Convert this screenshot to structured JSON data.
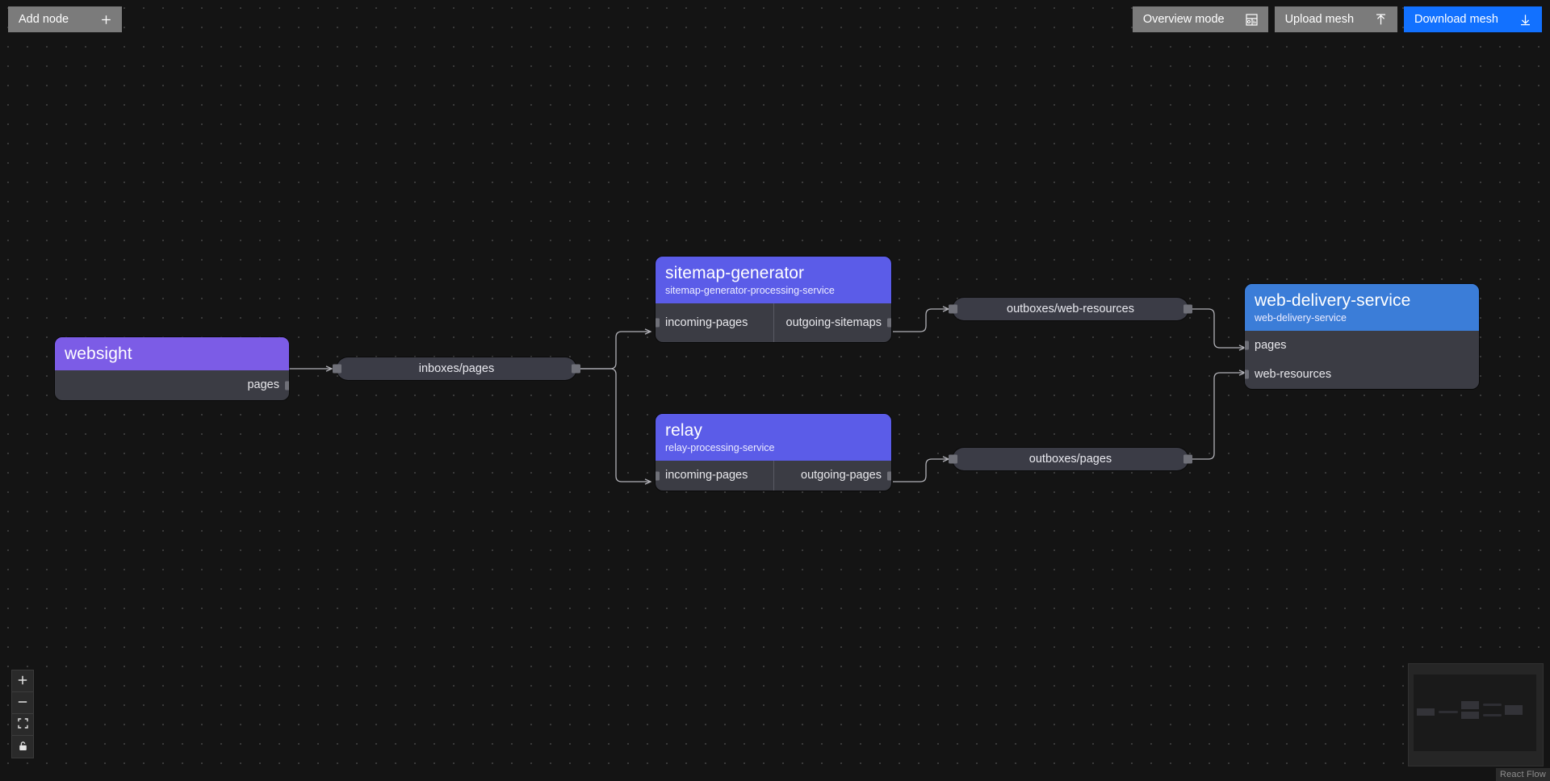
{
  "toolbar": {
    "add_node": {
      "label": "Add node",
      "icon": "plus-icon"
    },
    "overview_mode": {
      "label": "Overview mode",
      "icon": "layout-grid-icon"
    },
    "upload_mesh": {
      "label": "Upload mesh",
      "icon": "upload-icon"
    },
    "download_mesh": {
      "label": "Download mesh",
      "icon": "download-icon",
      "color": "#1271ff"
    }
  },
  "canvas": {
    "background": "#141414",
    "dot_color": "#3a3a3a",
    "edge_color": "#b1b1b7"
  },
  "nodes": [
    {
      "id": "websight",
      "title": "websight",
      "subtitle": "",
      "header_color": "#7c5ce6",
      "ports_in": [],
      "ports_out": [
        "pages"
      ]
    },
    {
      "id": "sitemap-generator",
      "title": "sitemap-generator",
      "subtitle": "sitemap-generator-processing-service",
      "header_color": "#5b5ce8",
      "ports_in": [
        "incoming-pages"
      ],
      "ports_out": [
        "outgoing-sitemaps"
      ]
    },
    {
      "id": "relay",
      "title": "relay",
      "subtitle": "relay-processing-service",
      "header_color": "#5b5ce8",
      "ports_in": [
        "incoming-pages"
      ],
      "ports_out": [
        "outgoing-pages"
      ]
    },
    {
      "id": "web-delivery-service",
      "title": "web-delivery-service",
      "subtitle": "web-delivery-service",
      "header_color": "#3b7dd8",
      "ports_in": [
        "pages",
        "web-resources"
      ],
      "ports_out": []
    }
  ],
  "topics": [
    {
      "id": "inboxes-pages",
      "label": "inboxes/pages"
    },
    {
      "id": "outboxes-web-resources",
      "label": "outboxes/web-resources"
    },
    {
      "id": "outboxes-pages",
      "label": "outboxes/pages"
    }
  ],
  "controls": [
    {
      "name": "zoom-in",
      "glyph": "+"
    },
    {
      "name": "zoom-out",
      "glyph": "−"
    },
    {
      "name": "fit-view",
      "glyph": "fit"
    },
    {
      "name": "lock",
      "glyph": "lock"
    }
  ],
  "minimap": {
    "visible": true
  },
  "attribution": {
    "label": "React Flow"
  }
}
